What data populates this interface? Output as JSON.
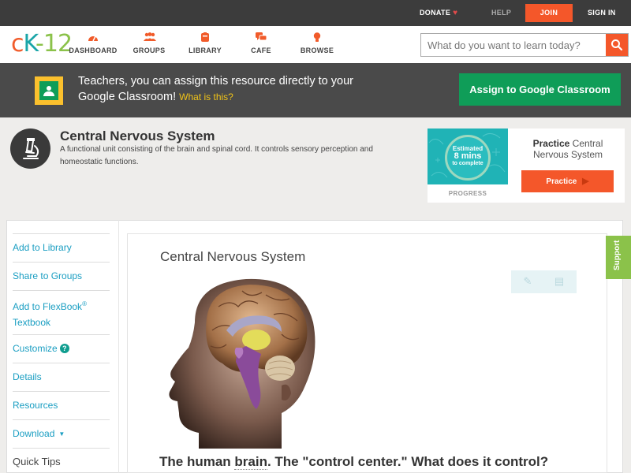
{
  "topbar": {
    "donate": "DONATE",
    "help": "HELP",
    "join": "JOIN",
    "signin": "SIGN IN"
  },
  "nav": {
    "logo": {
      "c": "c",
      "k": "K",
      "n": "-12"
    },
    "items": [
      {
        "label": "DASHBOARD",
        "icon": "dashboard-icon"
      },
      {
        "label": "GROUPS",
        "icon": "groups-icon"
      },
      {
        "label": "LIBRARY",
        "icon": "library-icon"
      },
      {
        "label": "CAFE",
        "icon": "cafe-icon"
      },
      {
        "label": "BROWSE",
        "icon": "browse-icon"
      }
    ],
    "search_placeholder": "What do you want to learn today?"
  },
  "banner": {
    "text": "Teachers, you can assign this resource directly to your Google Classroom!",
    "what_link": "What is this?",
    "button": "Assign to Google Classroom"
  },
  "concept": {
    "title": "Central Nervous System",
    "description": "A functional unit consisting of the brain and spinal cord. It controls sensory perception and homeostatic functions."
  },
  "practice": {
    "estimated": "Estimated",
    "mins": "8 mins",
    "to_complete": "to complete",
    "progress": "PROGRESS",
    "title_bold": "Practice",
    "title_rest": "Central Nervous System",
    "button": "Practice"
  },
  "sidebar": {
    "items": [
      {
        "label": "Add to Library"
      },
      {
        "label": "Share to Groups"
      },
      {
        "label": "Add to FlexBook",
        "sup": "®",
        "second": "Textbook"
      },
      {
        "label": "Customize"
      },
      {
        "label": "Details"
      },
      {
        "label": "Resources"
      },
      {
        "label": "Download"
      }
    ],
    "quick_tips": "Quick Tips"
  },
  "content": {
    "title": "Central Nervous System",
    "question_a": "The human ",
    "question_word": "brain",
    "question_b": ". The \"control center.\" What does it control?"
  },
  "support": "Support",
  "colors": {
    "accent": "#f4572a",
    "teal": "#1aa5a8",
    "green": "#0f9d58",
    "support": "#8bc24a"
  }
}
